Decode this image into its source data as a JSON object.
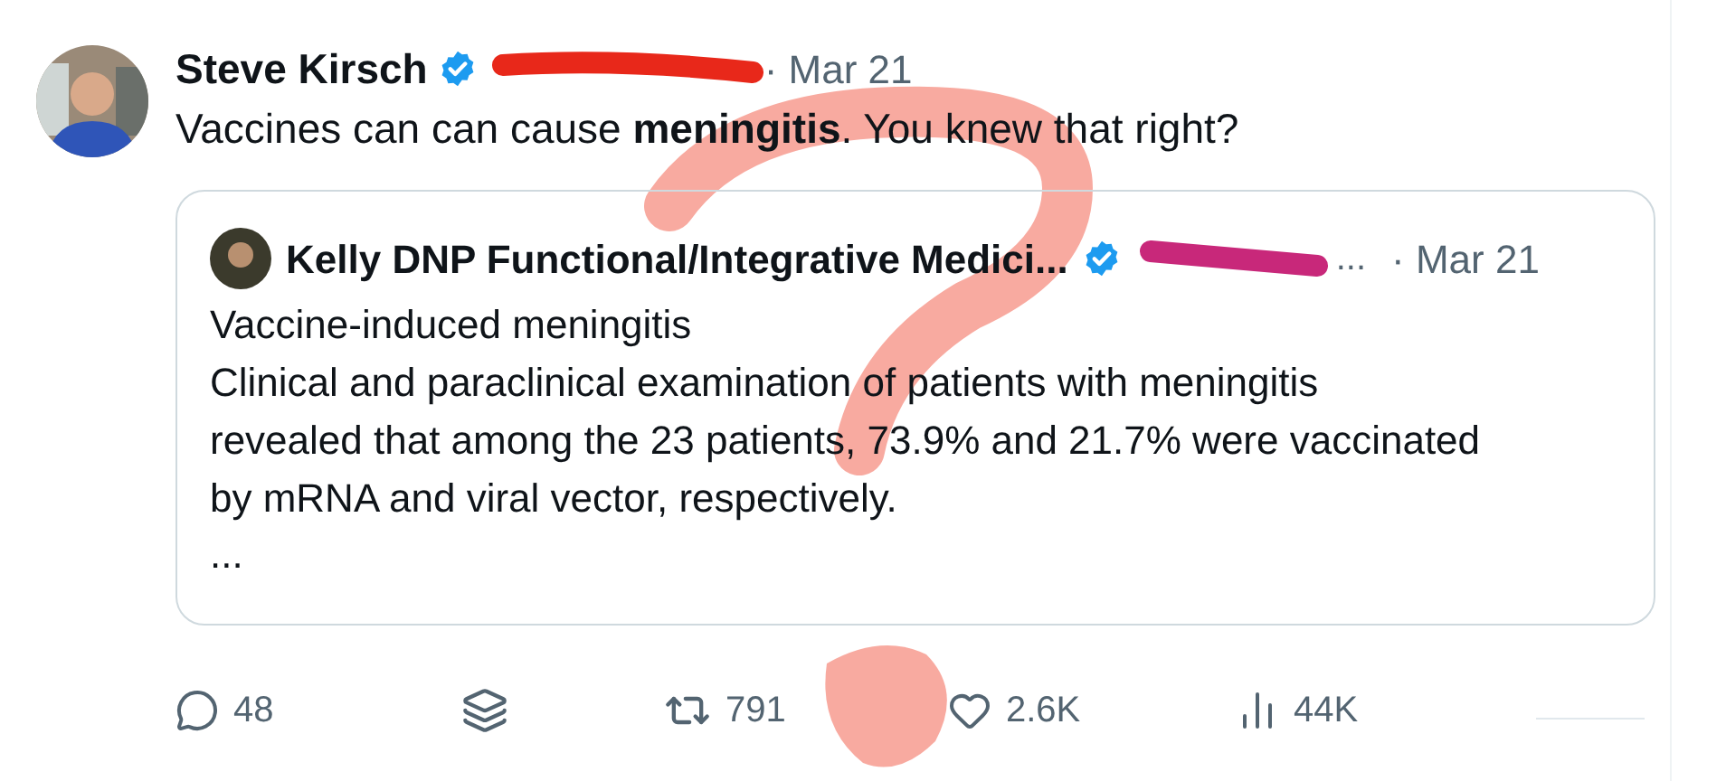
{
  "tweet": {
    "author": "Steve Kirsch",
    "verified": true,
    "date": "· Mar 21",
    "text": "Vaccines can can cause **meningitis**. You knew that right?",
    "quote": {
      "author": "Kelly DNP Functional/Integrative Medici...",
      "verified": true,
      "handle_tail": "...",
      "date": "· Mar 21",
      "title": "Vaccine-induced meningitis",
      "body_lines": [
        "Clinical and paraclinical examination of patients with meningitis",
        "revealed that among the 23 patients, 73.9% and 21.7% were vaccinated",
        "by mRNA and viral vector, respectively."
      ],
      "more": "..."
    },
    "actions": [
      {
        "kind": "reply",
        "count": "48"
      },
      {
        "kind": "stack"
      },
      {
        "kind": "retweet",
        "count": "791"
      },
      {
        "kind": "like",
        "count": "2.6K"
      },
      {
        "kind": "views",
        "count": "44K"
      }
    ]
  }
}
